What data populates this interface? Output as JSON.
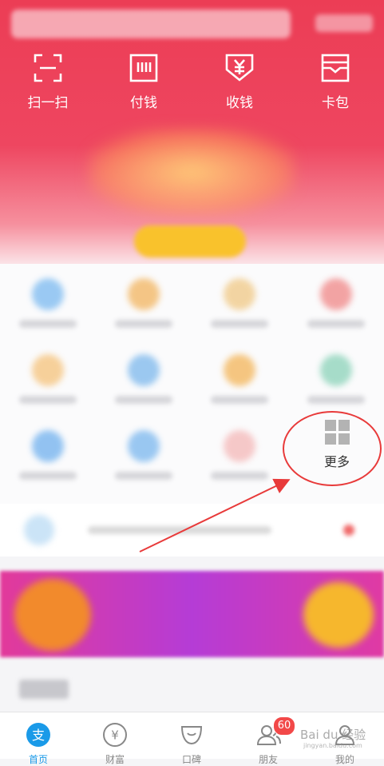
{
  "top_actions": [
    {
      "label": "扫一扫",
      "icon": "scan-icon"
    },
    {
      "label": "付钱",
      "icon": "pay-icon"
    },
    {
      "label": "收钱",
      "icon": "receive-icon"
    },
    {
      "label": "卡包",
      "icon": "card-wallet-icon"
    }
  ],
  "grid": {
    "more_label": "更多"
  },
  "tabbar": {
    "items": [
      {
        "label": "首页",
        "icon": "alipay-home-icon"
      },
      {
        "label": "财富",
        "icon": "wealth-icon"
      },
      {
        "label": "口碑",
        "icon": "koubei-icon"
      },
      {
        "label": "朋友",
        "icon": "friends-icon"
      },
      {
        "label": "我的",
        "icon": "profile-icon"
      }
    ],
    "friends_badge": "60",
    "home_icon_char": "支",
    "wealth_icon_char": "¥"
  },
  "watermark": {
    "text": "Bai du 经验",
    "url": "jingyan.baidu.com"
  },
  "colors": {
    "header_red": "#ec3d55",
    "accent_blue": "#1a9ae8",
    "annotation_red": "#e83a3a",
    "badge_red": "#f24848"
  }
}
